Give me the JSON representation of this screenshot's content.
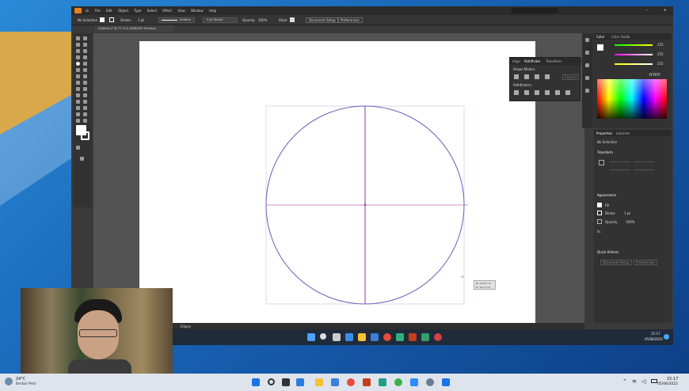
{
  "window": {
    "title": "Untitled-1* @ 77.11% (RGB/GPU Preview)",
    "menu": [
      "File",
      "Edit",
      "Object",
      "Type",
      "Select",
      "Effect",
      "View",
      "Window",
      "Help"
    ],
    "controls": {
      "minimize": "–",
      "maximize": "□",
      "close": "✕"
    }
  },
  "control_bar": {
    "selection": "No Selection",
    "stroke_label": "Stroke:",
    "stroke_value": "1 pt",
    "uniform": "Uniform",
    "brush": "5 pt. Round",
    "opacity_label": "Opacity:",
    "opacity_value": "100%",
    "style_label": "Style:",
    "doc_setup": "Document Setup",
    "preferences": "Preferences"
  },
  "shape_builder": {
    "tabs": [
      "Align",
      "Pathfinder",
      "Transform"
    ],
    "section1": "Shape Modes:",
    "section2": "Pathfinders:",
    "expand": "Expand"
  },
  "color_panel": {
    "tabs": [
      "Color",
      "Color Guide"
    ],
    "values": [
      "255",
      "255",
      "255"
    ],
    "hex": "FFFFFF"
  },
  "properties": {
    "tabs": [
      "Properties",
      "Libraries"
    ],
    "no_selection": "No Selection",
    "transform": "Transform",
    "appearance": "Appearance",
    "fill": "Fill",
    "stroke": "Stroke",
    "stroke_val": "1 pt",
    "opacity": "Opacity",
    "opacity_val": "100%",
    "fx": "fx.",
    "quick_actions": "Quick Actions",
    "qa": [
      "Document Setup",
      "Preferences"
    ]
  },
  "canvas": {
    "tooltip_line1": "W: 13.52 cm",
    "tooltip_line2": "H: 14.77 cm"
  },
  "status_bar": {
    "zoom": "77.11%",
    "tool": "Ellipse"
  },
  "inner_taskbar": {
    "time": "15:17",
    "date": "05/06/2022"
  },
  "taskbar": {
    "weather_temp": "24°C",
    "weather_desc": "Berbal Petir",
    "time": "15:17",
    "date": "05/06/2022"
  },
  "colors": {
    "ellipse": "#6a5fb7",
    "guide": "#b15ac6",
    "accent": "#1a73e8"
  }
}
